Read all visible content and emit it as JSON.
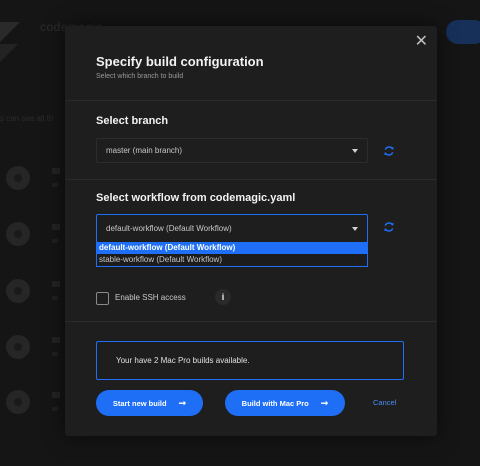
{
  "background": {
    "app_title": "codemagic",
    "partial_text": "s can see all th"
  },
  "modal": {
    "title": "Specify build configuration",
    "subtitle": "Select which branch to build",
    "close_glyph": "✕",
    "branch": {
      "title": "Select branch",
      "value": "master (main branch)"
    },
    "workflow": {
      "title": "Select workflow from codemagic.yaml",
      "value": "default-workflow (Default Workflow)",
      "options": [
        "default-workflow (Default Workflow)",
        "stable-workflow (Default Workflow)"
      ],
      "selected_index": 0
    },
    "ssh": {
      "label": "Enable SSH access",
      "checked": false,
      "info_glyph": "i"
    },
    "notice": "Your have 2 Mac Pro builds available.",
    "buttons": {
      "start": "Start new build",
      "mac_pro": "Build with Mac Pro",
      "cancel": "Cancel",
      "arrow_glyph": "➞"
    }
  },
  "icons": {
    "refresh": "refresh-icon",
    "close": "close-icon",
    "caret": "chevron-down-icon",
    "info": "info-icon",
    "arrow": "arrow-right-icon"
  },
  "colors": {
    "accent": "#1e6ff5",
    "modal_bg": "#1e1e1e",
    "page_bg": "#111111",
    "link": "#4a8ff7"
  }
}
